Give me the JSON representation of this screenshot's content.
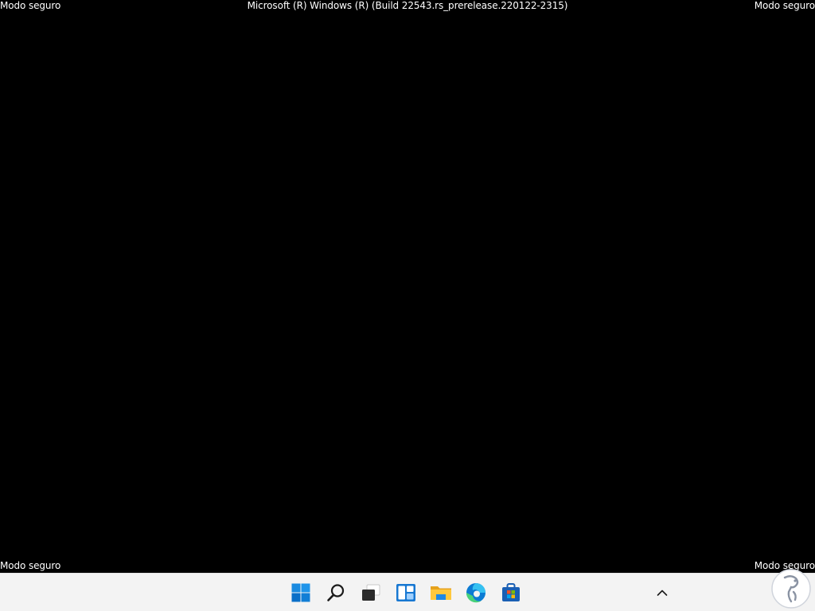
{
  "watermark": {
    "top_left": "Modo seguro",
    "top_right": "Modo seguro",
    "bottom_left": "Modo seguro",
    "bottom_right": "Modo seguro",
    "build": "Microsoft (R) Windows (R) (Build 22543.rs_prerelease.220122-2315)"
  },
  "taskbar": {
    "background": "#f3f3f3",
    "icons": [
      "windows-start-icon",
      "search-icon",
      "task-view-icon",
      "widgets-icon",
      "file-explorer-icon",
      "edge-browser-icon",
      "microsoft-store-icon"
    ],
    "tray": [
      "chevron-up-icon"
    ]
  },
  "colors": {
    "desktop": "#000000",
    "start_blue": "#0078d4",
    "explorer_yellow": "#f0b429"
  }
}
